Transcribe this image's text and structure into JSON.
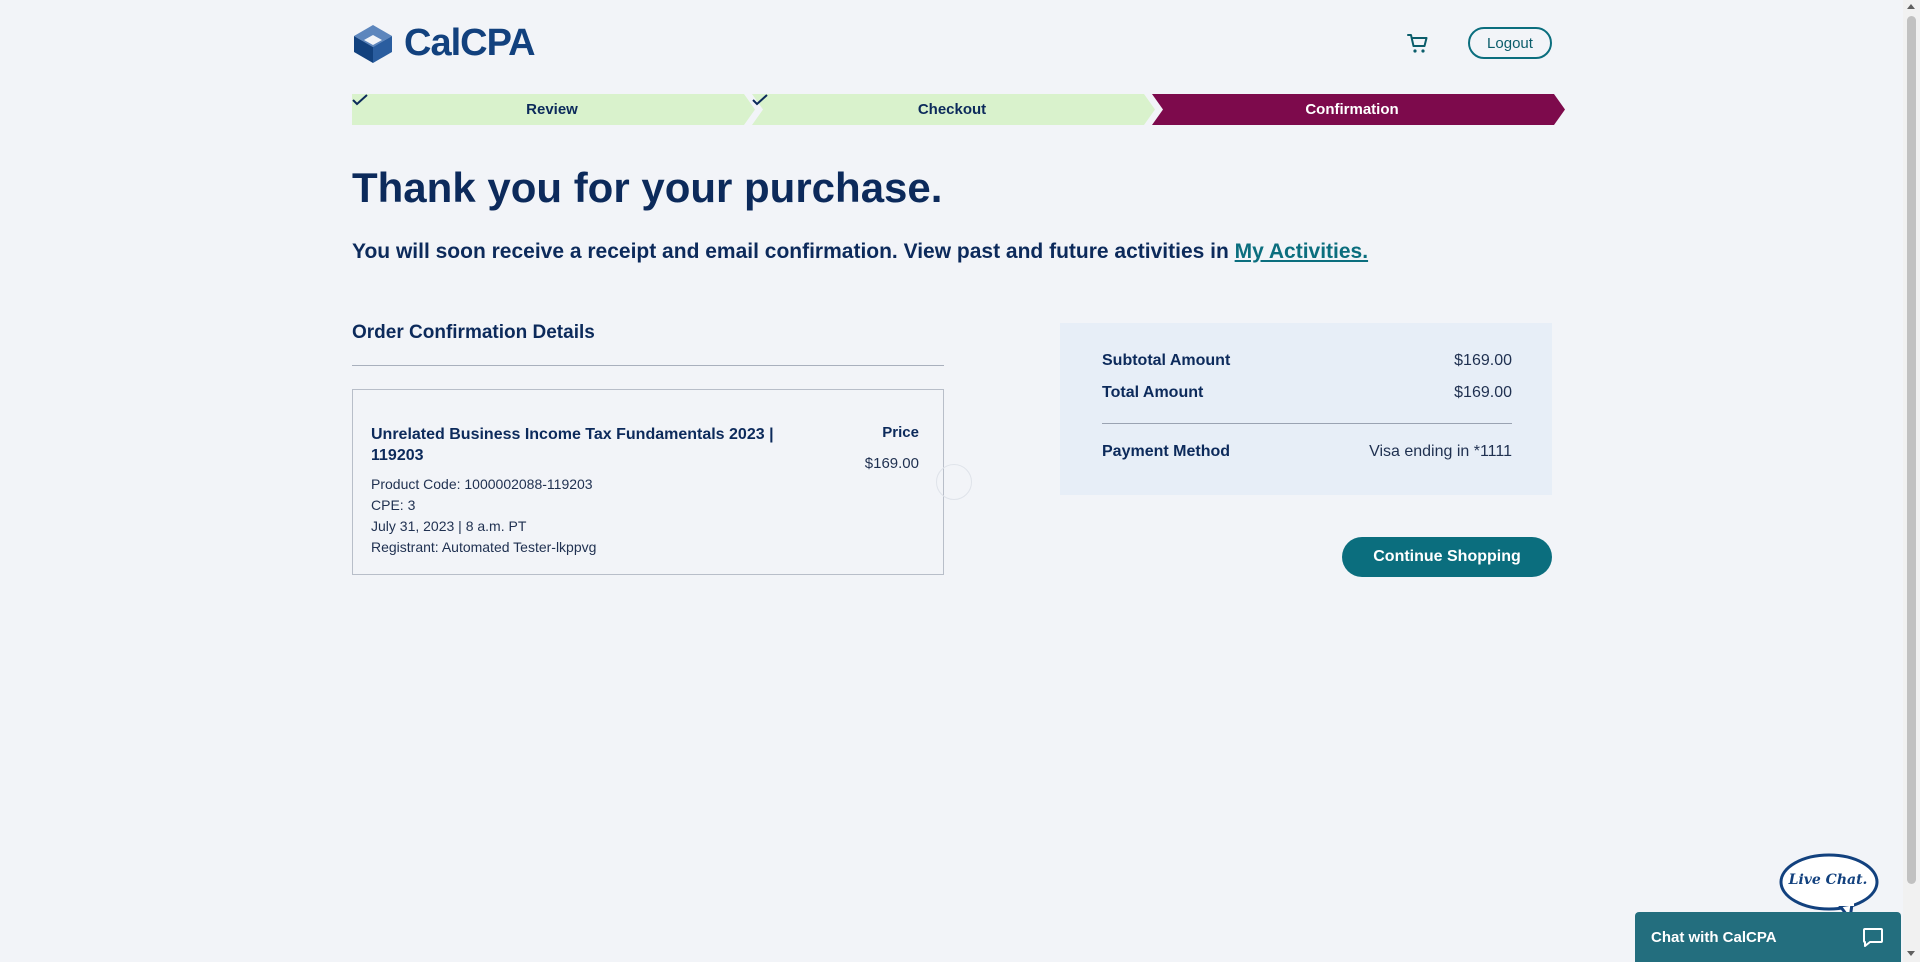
{
  "header": {
    "logo_text": "CalCPA",
    "cart_icon": "cart-icon",
    "logout_label": "Logout"
  },
  "steps": [
    {
      "label": "Review",
      "status": "complete"
    },
    {
      "label": "Checkout",
      "status": "complete"
    },
    {
      "label": "Confirmation",
      "status": "active"
    }
  ],
  "main": {
    "title": "Thank you for your purchase.",
    "subtitle_prefix": "You will soon receive a receipt and email confirmation. View past and future activities in ",
    "subtitle_link": "My Activities."
  },
  "order": {
    "heading": "Order Confirmation Details",
    "item": {
      "title": "Unrelated Business Income Tax Fundamentals 2023 | 119203",
      "product_code": "Product Code: 1000002088-119203",
      "cpe": "CPE: 3",
      "date": "July 31, 2023 | 8 a.m. PT",
      "registrant": "Registrant: Automated Tester-lkppvg",
      "price_label": "Price",
      "price": "$169.00"
    }
  },
  "summary": {
    "subtotal_label": "Subtotal Amount",
    "subtotal": "$169.00",
    "total_label": "Total Amount",
    "total": "$169.00",
    "payment_label": "Payment Method",
    "payment": "Visa ending in *1111"
  },
  "continue_label": "Continue Shopping",
  "chat": {
    "bubble_text": "Live Chat.",
    "bar_label": "Chat with CalCPA"
  },
  "colors": {
    "step_complete": "#d9f2cc",
    "step_active": "#7d0a4c",
    "accent": "#0b6e7e",
    "navy": "#0c2a5b"
  }
}
